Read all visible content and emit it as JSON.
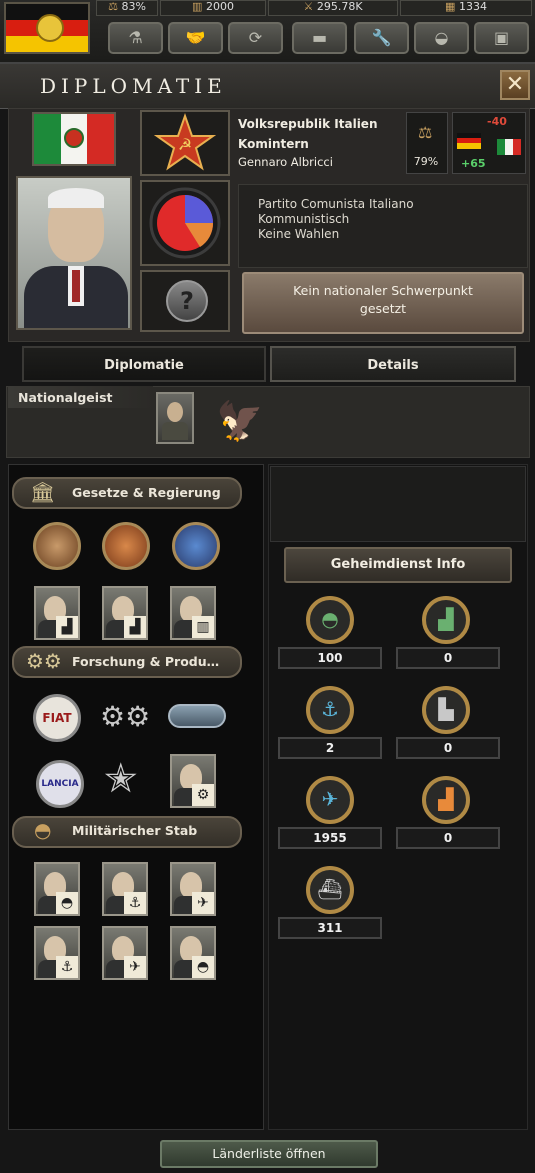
{
  "topbar": {
    "resources": [
      "83%",
      "2000",
      "295.78K",
      "1334"
    ]
  },
  "window": {
    "title": "Diplomatie",
    "close_label": "✕"
  },
  "country": {
    "name": "Volksrepublik Italien",
    "faction": "Komintern",
    "leader": "Gennaro Albricci",
    "stability": "79%",
    "relation_negative": "-40",
    "relation_positive": "+65",
    "party": "Partito Comunista Italiano",
    "ideology": "Kommunistisch",
    "elections": "Keine Wahlen",
    "focus_line1": "Kein nationaler Schwerpunkt",
    "focus_line2": "gesetzt"
  },
  "tabs": {
    "diplomatie": "Diplomatie",
    "details": "Details"
  },
  "national_spirit": {
    "label": "Nationalgeist"
  },
  "sections": {
    "laws": "Gesetze & Regierung",
    "research": "Forschung & Produ…",
    "military": "Militärischer Stab"
  },
  "logos": {
    "fiat": "FIAT",
    "lancia": "LANCIA"
  },
  "intel": {
    "label": "Geheimdienst Info",
    "values": {
      "army": "100",
      "civil_factories": "0",
      "navy": "2",
      "dockyards": "0",
      "air": "1955",
      "military_factories": "0",
      "convoys": "311"
    }
  },
  "bottom": {
    "open_list": "Länderliste öffnen"
  },
  "colors": {
    "accent_gold": "#b08a45",
    "relation_red": "#e04a3a",
    "relation_green": "#5ad06a"
  }
}
